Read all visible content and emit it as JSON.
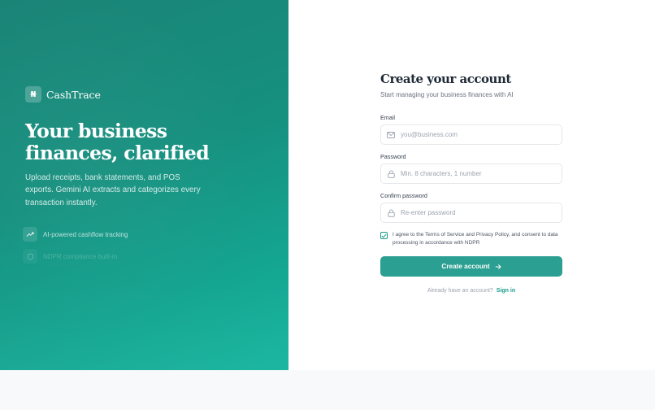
{
  "brand": {
    "logo_letter": "₦",
    "name": "CashTrace"
  },
  "hero": {
    "headline_line1": "Your business",
    "headline_line2": "finances, clarified",
    "description": "Upload receipts, bank statements, and POS exports. Gemini AI extracts and categorizes every transaction instantly."
  },
  "features": [
    {
      "label": "AI-powered cashflow tracking",
      "icon": "trending-up-icon"
    },
    {
      "label": "NDPR compliance built-in",
      "icon": "shield-icon"
    }
  ],
  "form": {
    "title": "Create your account",
    "subtitle": "Start managing your business finances with AI",
    "email_label": "Email",
    "email_placeholder": "you@business.com",
    "password_label": "Password",
    "password_placeholder": "Min. 8 characters, 1 number",
    "confirm_label": "Confirm password",
    "confirm_placeholder": "Re-enter password",
    "agree_text": "I agree to the Terms of Service and Privacy Policy, and consent to data processing in accordance with NDPR",
    "agree_checked": true,
    "submit_label": "Create account",
    "signin_prompt": "Already have an account?",
    "signin_link": "Sign in"
  },
  "colors": {
    "accent": "#2b9f92",
    "panel_start": "#1a8477",
    "panel_end": "#15b59e"
  }
}
